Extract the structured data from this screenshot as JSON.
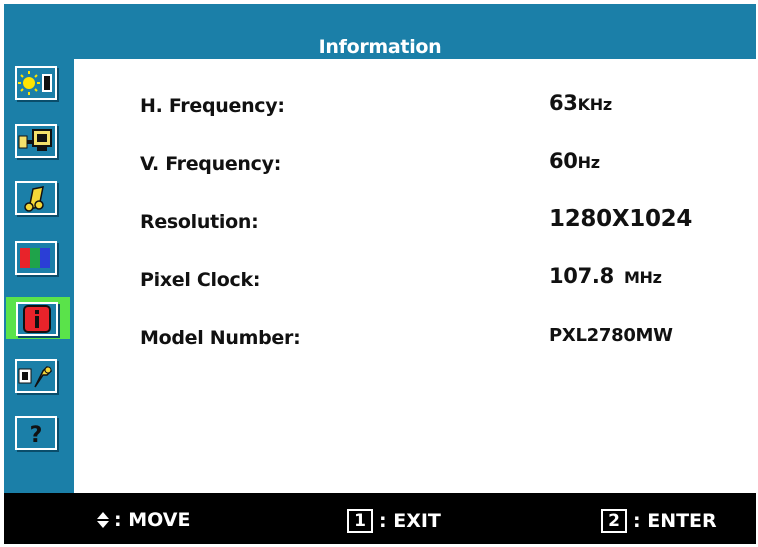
{
  "window": {
    "title": "Information"
  },
  "sidebar": {
    "items": [
      {
        "icon": "brightness-contrast-icon",
        "active": false
      },
      {
        "icon": "input-source-icon",
        "active": false
      },
      {
        "icon": "audio-icon",
        "active": false
      },
      {
        "icon": "color-adjust-icon",
        "active": false
      },
      {
        "icon": "information-icon",
        "active": true
      },
      {
        "icon": "setup-menu-icon",
        "active": false
      },
      {
        "icon": "help-icon",
        "active": false
      }
    ]
  },
  "info": {
    "rows": [
      {
        "label": "H. Frequency",
        "colon": ":",
        "value_num": "63",
        "value_unit": "KHz"
      },
      {
        "label": "V. Frequency",
        "colon": ":",
        "value_num": "60",
        "value_unit": "Hz"
      },
      {
        "label": "Resolution",
        "colon": ":",
        "value_num": "1280X1024",
        "value_unit": ""
      },
      {
        "label": "Pixel Clock",
        "colon": ":",
        "value_num": "107.8",
        "value_unit": "MHz"
      },
      {
        "label": "Model Number",
        "colon": ":",
        "value_num": "PXL2780MW",
        "value_unit": ""
      }
    ]
  },
  "footer": {
    "move_label": ": MOVE",
    "exit_key": "1",
    "exit_label": ": EXIT",
    "enter_key": "2",
    "enter_label": ": ENTER"
  },
  "colors": {
    "osd_blue": "#1b7fa8",
    "active_green": "#5ae34a",
    "footer_black": "#000000"
  }
}
